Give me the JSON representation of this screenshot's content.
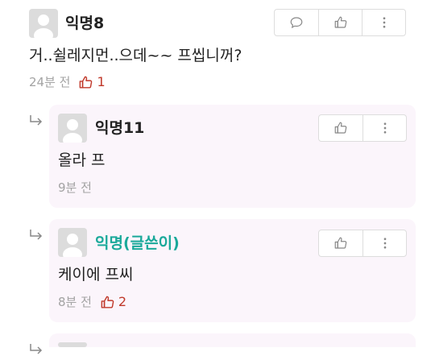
{
  "comments": [
    {
      "name": "익명8",
      "text": "거..쉴레지먼..으데~~ 프씹니꺼?",
      "time": "24분 전",
      "likes": "1"
    },
    {
      "name": "익명11",
      "text": "올라 프",
      "time": "9분 전"
    },
    {
      "name": "익명(글쓴이)",
      "text": "케이에 프씨",
      "time": "8분 전",
      "likes": "2"
    }
  ],
  "colors": {
    "author": "#1aa99a",
    "like": "#c0392b",
    "reply_bg": "#fbf5fb"
  },
  "icons": [
    "comment-icon",
    "thumbs-up-icon",
    "more-vertical-icon",
    "reply-arrow-icon",
    "avatar-placeholder"
  ]
}
